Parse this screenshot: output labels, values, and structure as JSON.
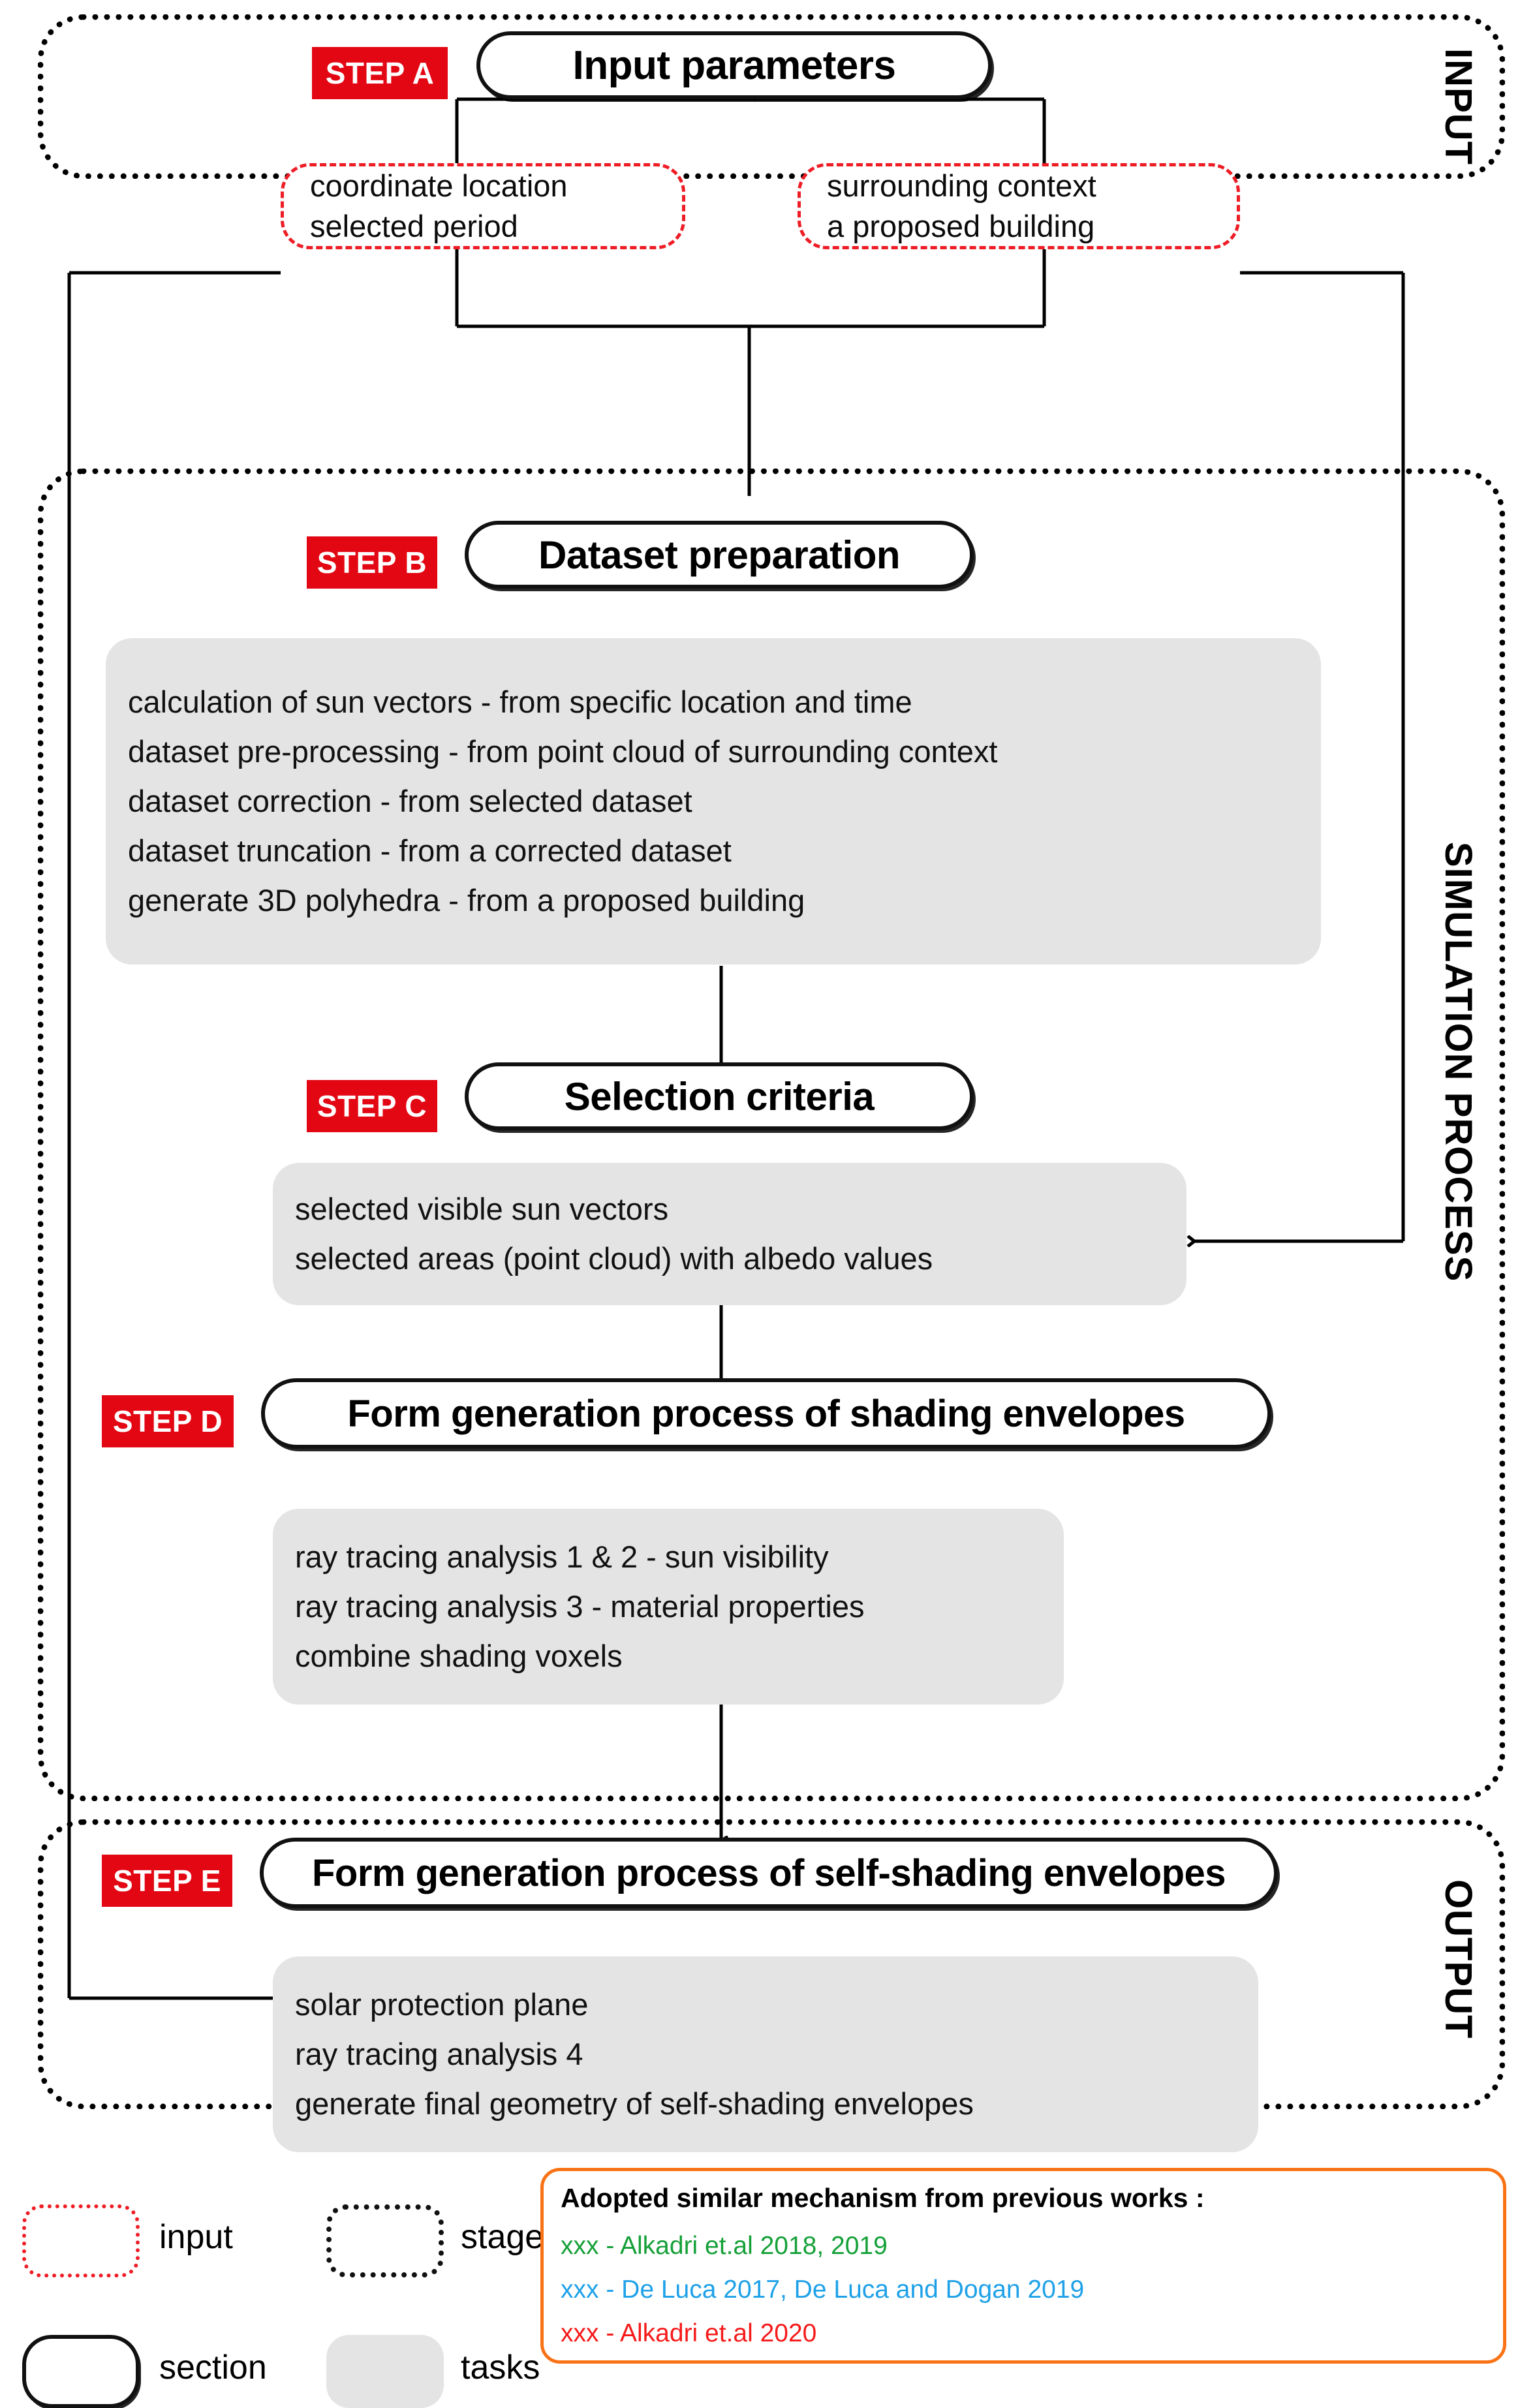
{
  "colors": {
    "step_badge_bg": "#e30613",
    "input_border": "#ee1c25",
    "stage_border": "#000000",
    "tasks_bg": "#e4e4e4",
    "ref_border": "#f97316",
    "green": "#15a038",
    "blue": "#1ea1e8",
    "red": "#f61a1a",
    "black": "#111111"
  },
  "stages": [
    {
      "id": "input",
      "label": "INPUT"
    },
    {
      "id": "simulation",
      "label": "SIMULATION PROCESS"
    },
    {
      "id": "output",
      "label": "OUTPUT"
    }
  ],
  "steps": {
    "a": {
      "badge": "STEP A",
      "section_title": "Input parameters",
      "inputs": [
        {
          "lines": [
            "coordinate location",
            "selected period"
          ]
        },
        {
          "lines": [
            "surrounding context",
            "a proposed building"
          ]
        }
      ]
    },
    "b": {
      "badge": "STEP B",
      "section_title": "Dataset preparation",
      "tasks": [
        {
          "text": "calculation of sun vectors - from specific location and time",
          "color": "black"
        },
        {
          "text": "dataset pre-processing - from point cloud of surrounding context",
          "color": "black"
        },
        {
          "text": "dataset correction - from selected dataset",
          "color": "green"
        },
        {
          "text": "dataset truncation - from a corrected dataset",
          "color": "black"
        },
        {
          "text": "generate 3D polyhedra - from a proposed building",
          "color": "blue"
        }
      ]
    },
    "c": {
      "badge": "STEP C",
      "section_title": "Selection criteria",
      "tasks": [
        {
          "text": "selected visible sun vectors",
          "color": "red"
        },
        {
          "text": "selected areas (point cloud) with albedo values",
          "color": "green"
        }
      ]
    },
    "d": {
      "badge": "STEP D",
      "section_title": "Form generation process of shading envelopes",
      "tasks": [
        {
          "text": "ray tracing analysis 1 & 2 - sun visibility",
          "color": "red"
        },
        {
          "text": "ray tracing analysis 3 - material properties",
          "color": "red"
        },
        {
          "text": "combine shading voxels",
          "color": "black"
        }
      ]
    },
    "e": {
      "badge": "STEP E",
      "section_title": "Form generation process of self-shading envelopes",
      "tasks": [
        {
          "text": "solar protection plane",
          "color": "black"
        },
        {
          "text": "ray tracing analysis 4",
          "color": "black"
        },
        {
          "text": "generate final geometry of self-shading envelopes",
          "color": "black"
        }
      ]
    }
  },
  "legend": {
    "items": [
      {
        "key": "input",
        "label": "input"
      },
      {
        "key": "stage",
        "label": "stage"
      },
      {
        "key": "section",
        "label": "section"
      },
      {
        "key": "tasks",
        "label": "tasks"
      }
    ]
  },
  "references": {
    "title": "Adopted similar mechanism from previous works :",
    "lines": [
      {
        "text": "xxx - Alkadri et.al 2018, 2019",
        "color": "green"
      },
      {
        "text": "xxx - De Luca 2017, De Luca and Dogan 2019",
        "color": "blue"
      },
      {
        "text": "xxx - Alkadri et.al 2020",
        "color": "red"
      }
    ]
  }
}
